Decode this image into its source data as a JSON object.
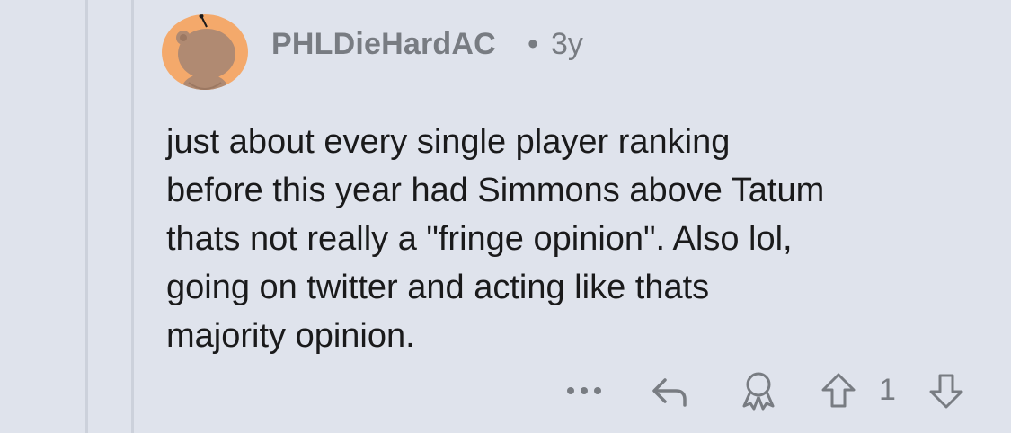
{
  "comment": {
    "username": "PHLDieHardAC",
    "separator": "•",
    "age": "3y",
    "body_lines": [
      "just about every single player ranking",
      "before this year had Simmons above Tatum",
      "thats not really a \"fringe opinion\". Also lol,",
      "going on twitter and acting like thats",
      "majority opinion."
    ],
    "score": "1"
  },
  "icons": {
    "avatar": "snoo-avatar",
    "more": "more-options-icon",
    "reply": "reply-icon",
    "award": "award-icon",
    "upvote": "upvote-icon",
    "downvote": "downvote-icon"
  },
  "colors": {
    "background": "#dfe3ec",
    "thread_line": "#ccd1db",
    "avatar_bg": "#f4a96b",
    "avatar_figure": "#b08a72",
    "meta_text": "#787c82",
    "body_text": "#1a1a1b"
  }
}
